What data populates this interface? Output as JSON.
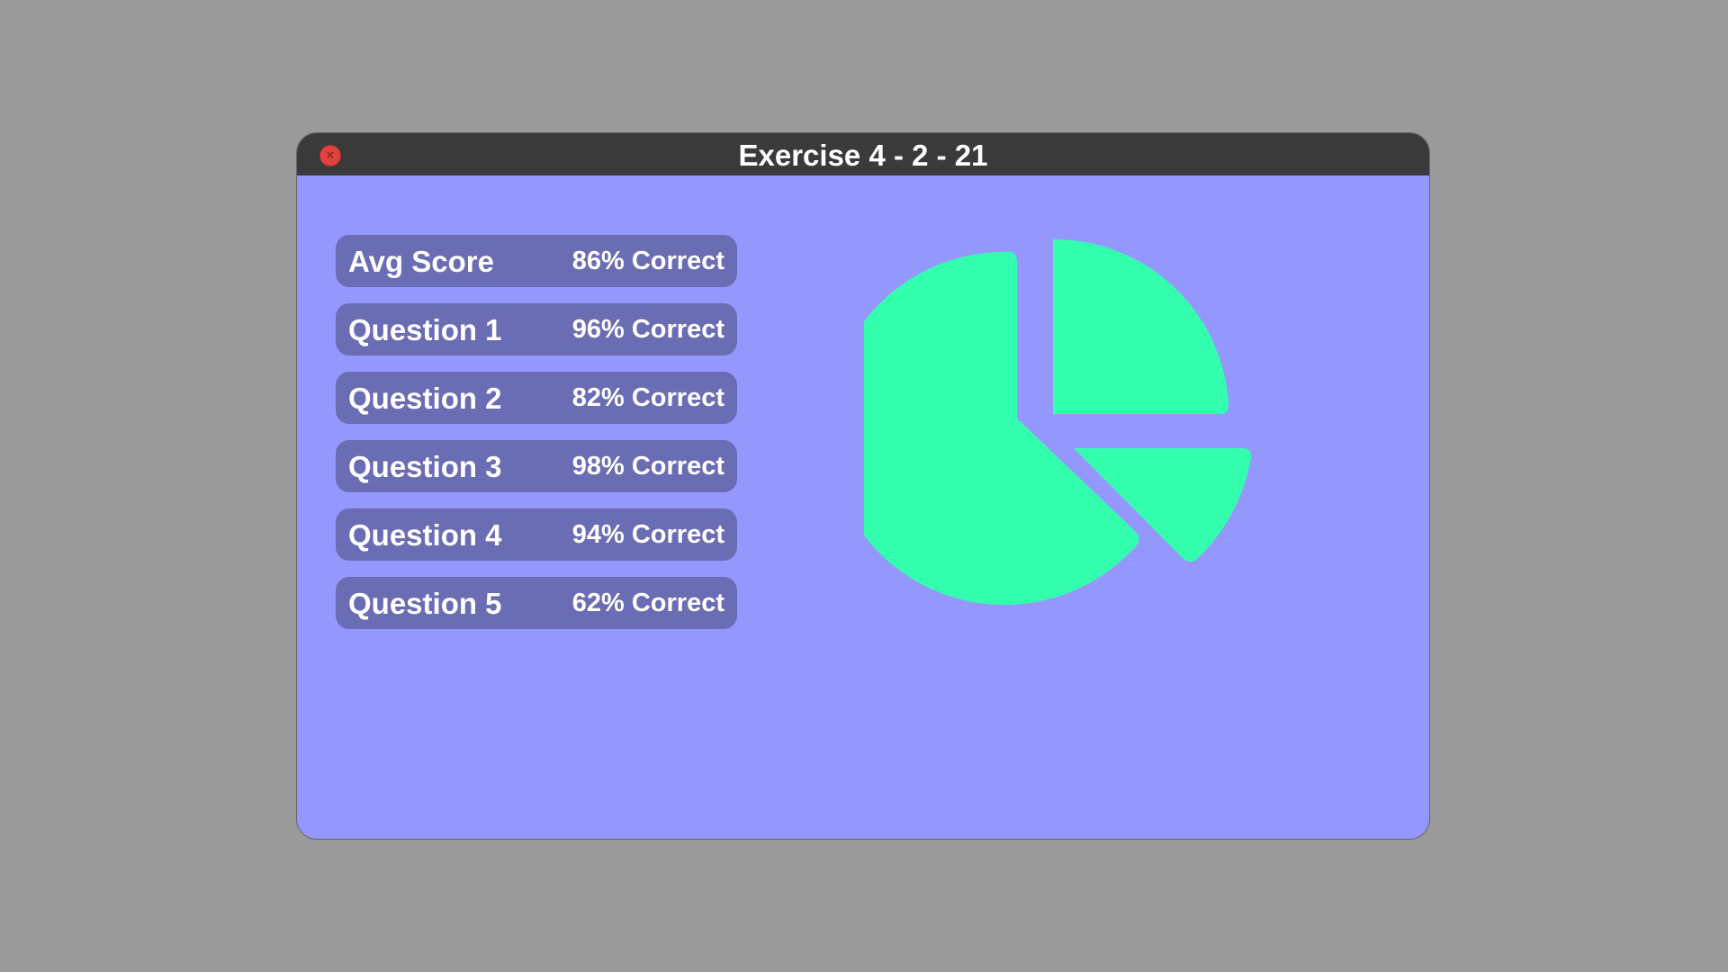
{
  "window": {
    "title": "Exercise 4 - 2 - 21"
  },
  "scores": [
    {
      "label": "Avg Score",
      "value": "86% Correct"
    },
    {
      "label": "Question 1",
      "value": "96% Correct"
    },
    {
      "label": "Question 2",
      "value": "82% Correct"
    },
    {
      "label": "Question 3",
      "value": "98% Correct"
    },
    {
      "label": "Question 4",
      "value": "94% Correct"
    },
    {
      "label": "Question 5",
      "value": "62% Correct"
    }
  ],
  "icons": {
    "close": "close-icon",
    "chart": "pie-chart-icon"
  },
  "colors": {
    "background": "#9a9a9a",
    "window": "#9498fd",
    "titlebar": "#3a3a3a",
    "row": "#6a6db3",
    "pie": "#33ffaf",
    "close": "#e2423f"
  }
}
